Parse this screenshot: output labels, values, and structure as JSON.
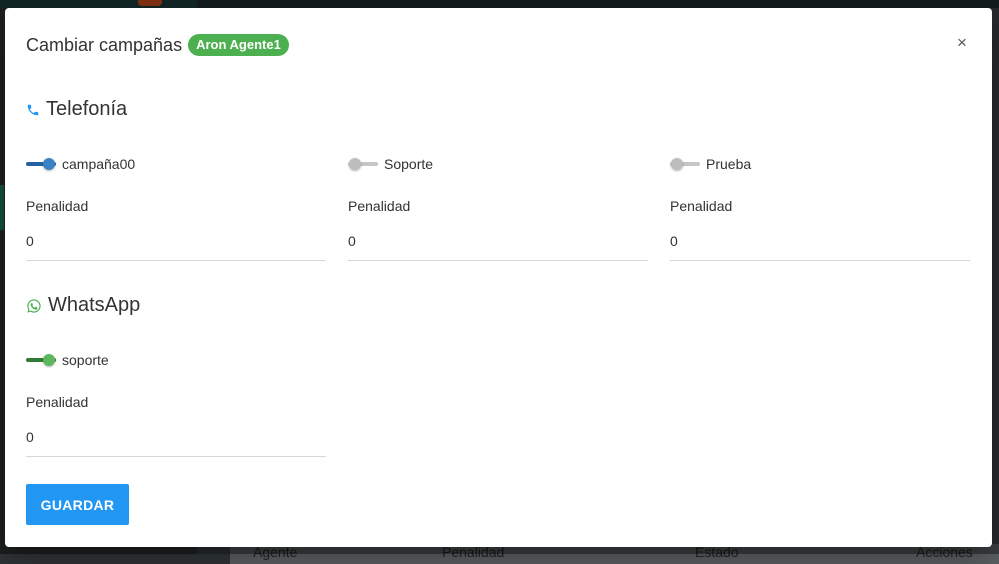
{
  "modal": {
    "title": "Cambiar campañas",
    "agent_badge": "Aron Agente1",
    "close_label": "×",
    "save_label": "GUARDAR"
  },
  "telefonia": {
    "title": "Telefonía",
    "icon": "phone-icon",
    "accent": "#2196f3",
    "campaigns": [
      {
        "name": "campaña00",
        "enabled": true,
        "penalty_label": "Penalidad",
        "penalty_value": "0"
      },
      {
        "name": "Soporte",
        "enabled": false,
        "penalty_label": "Penalidad",
        "penalty_value": "0"
      },
      {
        "name": "Prueba",
        "enabled": false,
        "penalty_label": "Penalidad",
        "penalty_value": "0"
      }
    ]
  },
  "whatsapp": {
    "title": "WhatsApp",
    "icon": "whatsapp-icon",
    "accent": "#4caf50",
    "campaigns": [
      {
        "name": "soporte",
        "enabled": true,
        "penalty_label": "Penalidad",
        "penalty_value": "0"
      }
    ]
  },
  "background_table": {
    "headers": [
      "Agente",
      "Penalidad",
      "Estado",
      "Acciones"
    ]
  }
}
